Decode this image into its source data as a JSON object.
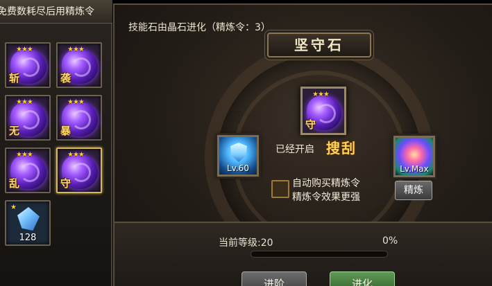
{
  "left_panel": {
    "header": "免费数耗尽后用精炼令",
    "gems": [
      {
        "stars": "★★★",
        "char": "斩"
      },
      {
        "stars": "★★★",
        "char": "袭"
      },
      {
        "stars": "★★★",
        "char": "无"
      },
      {
        "stars": "★★★",
        "char": "暴"
      },
      {
        "stars": "★★★",
        "char": "乱"
      },
      {
        "stars": "★★★",
        "char": "守",
        "selected": true
      }
    ],
    "crystal": {
      "stars": "★",
      "count": "128"
    }
  },
  "main": {
    "title": "技能石由晶石进化（精炼令：3）",
    "stone_name": "坚守石",
    "center_gem": {
      "stars": "★★★",
      "char": "守"
    },
    "skill_level": "Lv.60",
    "opened_text": "已经开启",
    "skill_name": "搜刮",
    "max_level": "Lv.Max",
    "refine_button": "精炼",
    "auto_buy_line1": "自动购买精炼令",
    "auto_buy_line2": "精炼令效果更强",
    "current_level": "当前等级:20",
    "progress_text": "0%",
    "progress": 0,
    "advance_button": "进阶",
    "evolve_button": "进化"
  }
}
